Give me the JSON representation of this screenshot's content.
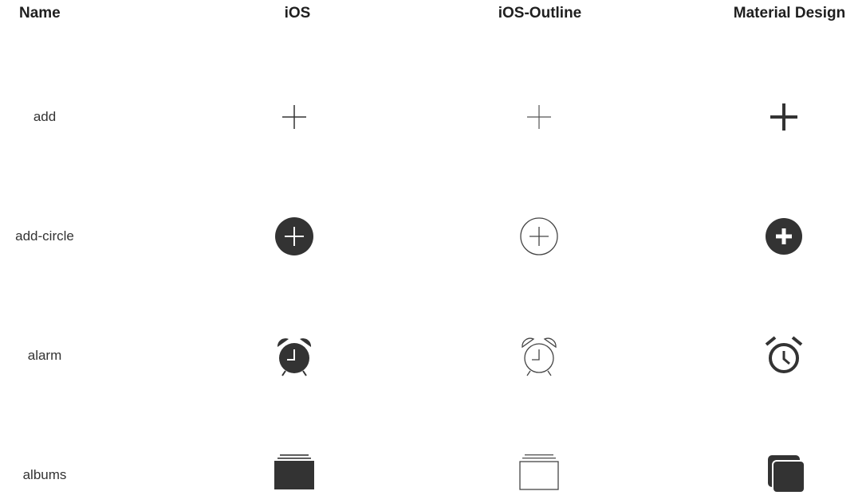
{
  "header": {
    "name": "Name",
    "ios": "iOS",
    "ios_outline": "iOS-Outline",
    "material": "Material Design"
  },
  "rows": [
    {
      "name": "add",
      "icons": {
        "ios": "add-icon",
        "ios_outline": "add-outline-icon",
        "material": "add-material-icon"
      }
    },
    {
      "name": "add-circle",
      "icons": {
        "ios": "add-circle-icon",
        "ios_outline": "add-circle-outline-icon",
        "material": "add-circle-material-icon"
      }
    },
    {
      "name": "alarm",
      "icons": {
        "ios": "alarm-icon",
        "ios_outline": "alarm-outline-icon",
        "material": "alarm-material-icon"
      }
    },
    {
      "name": "albums",
      "icons": {
        "ios": "albums-icon",
        "ios_outline": "albums-outline-icon",
        "material": "albums-material-icon"
      }
    }
  ],
  "colors": {
    "icon_fill": "#333333",
    "text": "#222222",
    "background": "#ffffff"
  }
}
